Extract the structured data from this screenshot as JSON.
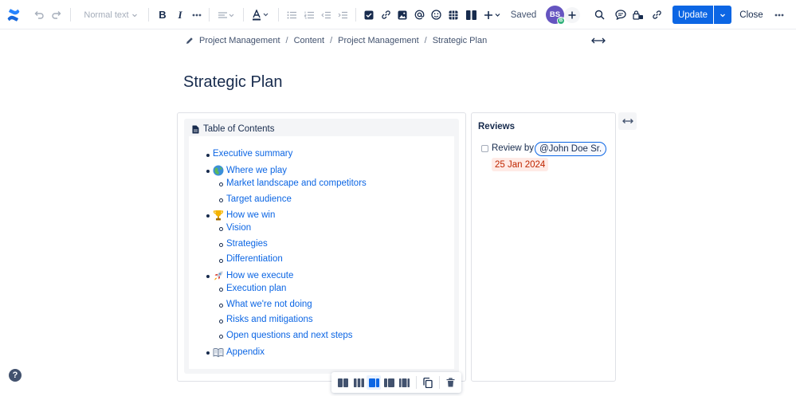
{
  "toolbar": {
    "text_style": "Normal text",
    "saved_label": "Saved",
    "avatar_initials": "BS",
    "avatar_badge": "B",
    "update_label": "Update",
    "close_label": "Close"
  },
  "breadcrumb": [
    "Project Management",
    "Content",
    "Project Management",
    "Strategic Plan"
  ],
  "page_title": "Strategic Plan",
  "toc": {
    "heading": "Table of Contents",
    "items": [
      {
        "label": "Executive summary",
        "level": 1,
        "emoji": ""
      },
      {
        "label": "Where we play",
        "level": 1,
        "emoji": "globe"
      },
      {
        "label": "Market landscape and competitors",
        "level": 2,
        "emoji": ""
      },
      {
        "label": "Target audience",
        "level": 2,
        "emoji": ""
      },
      {
        "label": "How we win",
        "level": 1,
        "emoji": "trophy"
      },
      {
        "label": "Vision",
        "level": 2,
        "emoji": ""
      },
      {
        "label": "Strategies",
        "level": 2,
        "emoji": ""
      },
      {
        "label": "Differentiation",
        "level": 2,
        "emoji": ""
      },
      {
        "label": "How we execute",
        "level": 1,
        "emoji": "rocket"
      },
      {
        "label": "Execution plan",
        "level": 2,
        "emoji": ""
      },
      {
        "label": "What we're not doing",
        "level": 2,
        "emoji": ""
      },
      {
        "label": "Risks and mitigations",
        "level": 2,
        "emoji": ""
      },
      {
        "label": "Open questions and next steps",
        "level": 2,
        "emoji": ""
      },
      {
        "label": "Appendix",
        "level": 1,
        "emoji": "book"
      }
    ]
  },
  "reviews": {
    "title": "Reviews",
    "review_label": "Review by",
    "mention": "@John Doe Sr.",
    "date": "25 Jan 2024"
  },
  "colors": {
    "accent": "#0c66e4",
    "date_bg": "#ffebe6",
    "date_text": "#bf2600",
    "avatar": "#6554c0"
  }
}
